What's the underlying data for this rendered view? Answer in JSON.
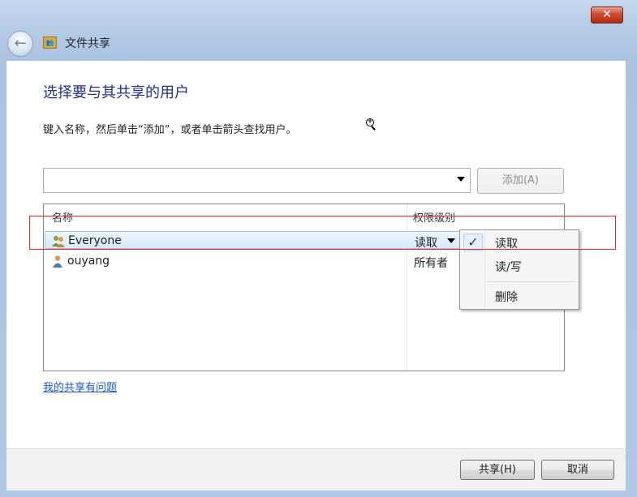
{
  "window": {
    "title": "文件共享",
    "close_glyph": "✕",
    "back_glyph": "←"
  },
  "content": {
    "heading": "选择要与其共享的用户",
    "instruction": "键入名称，然后单击“添加”，或者单击箭头查找用户。",
    "name_input": {
      "value": "",
      "placeholder": ""
    },
    "add_button": "添加(A)"
  },
  "list": {
    "columns": [
      "名称",
      "权限级别"
    ],
    "rows": [
      {
        "name": "Everyone",
        "permission": "读取",
        "icon": "group-users-icon",
        "selected": true
      },
      {
        "name": "ouyang",
        "permission": "所有者",
        "icon": "user-icon",
        "selected": false
      }
    ]
  },
  "permission_menu": {
    "check_glyph": "✓",
    "items": [
      "读取",
      "读/写",
      "删除"
    ],
    "checked_index": 0
  },
  "help_link": "我的共享有问题",
  "footer": {
    "share_button": "共享(H)",
    "cancel_button": "取消"
  },
  "colors": {
    "heading": "#1e3287",
    "link": "#1b56c8",
    "highlight_box": "#e0262a",
    "selection": "#d8e9fb"
  }
}
